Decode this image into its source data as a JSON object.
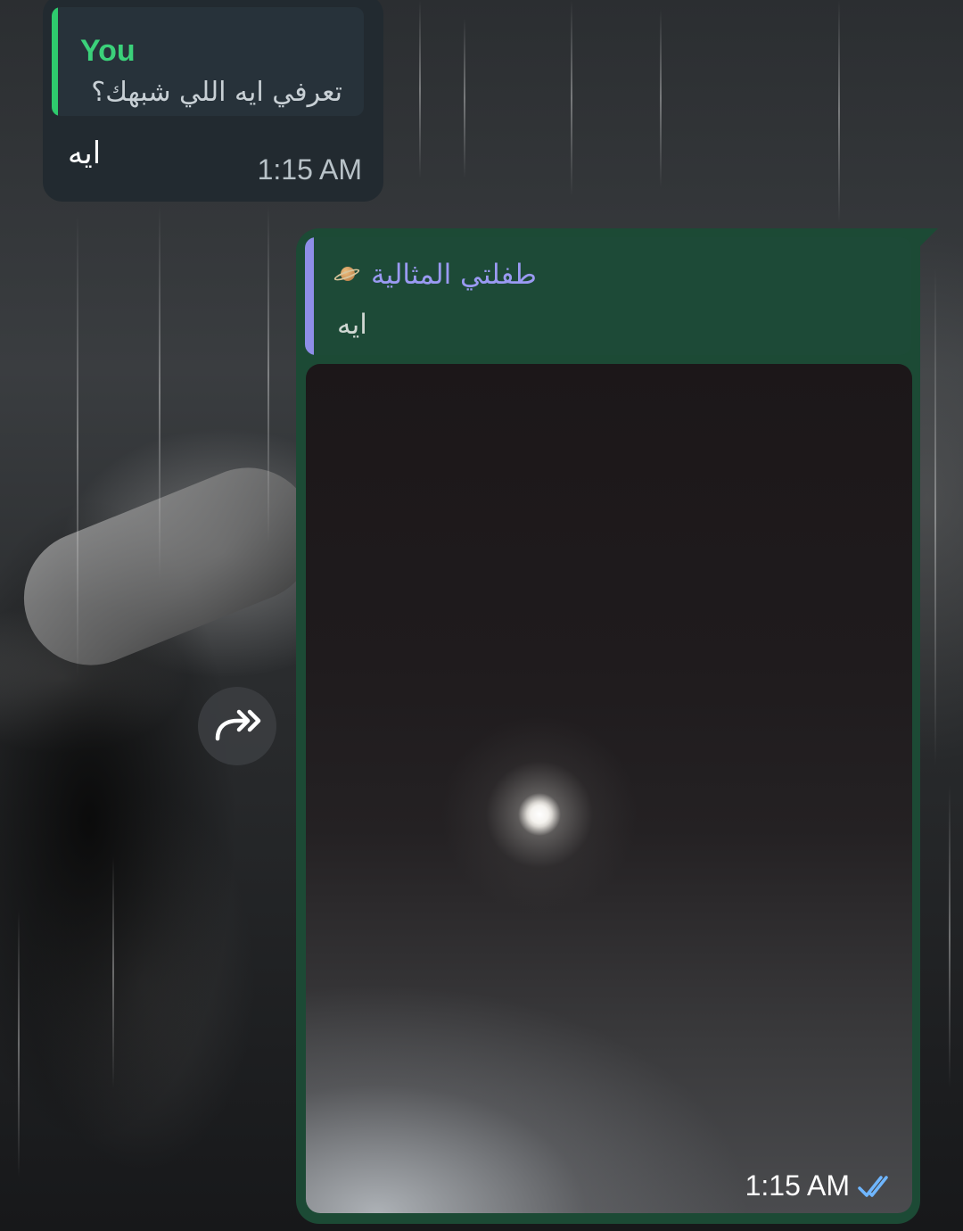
{
  "messages": {
    "incoming": {
      "reply": {
        "sender": "You",
        "text": "تعرفي ايه اللي شبهك؟"
      },
      "text": "ايه",
      "time": "1:15 AM"
    },
    "outgoing": {
      "reply": {
        "sender": "طفلتي المثالية",
        "sender_emoji_icon": "ringed-planet-icon",
        "text": "ايه"
      },
      "media": "photo",
      "time": "1:15 AM",
      "status_icon": "double-check-icon"
    }
  },
  "share_button_icon": "forward-share-icon",
  "colors": {
    "incoming_bubble": "#222a30",
    "outgoing_bubble": "#1c4a35",
    "you_name": "#3bd17a",
    "reply_name": "#9a9af2",
    "read_ticks": "#6fb6ff"
  }
}
